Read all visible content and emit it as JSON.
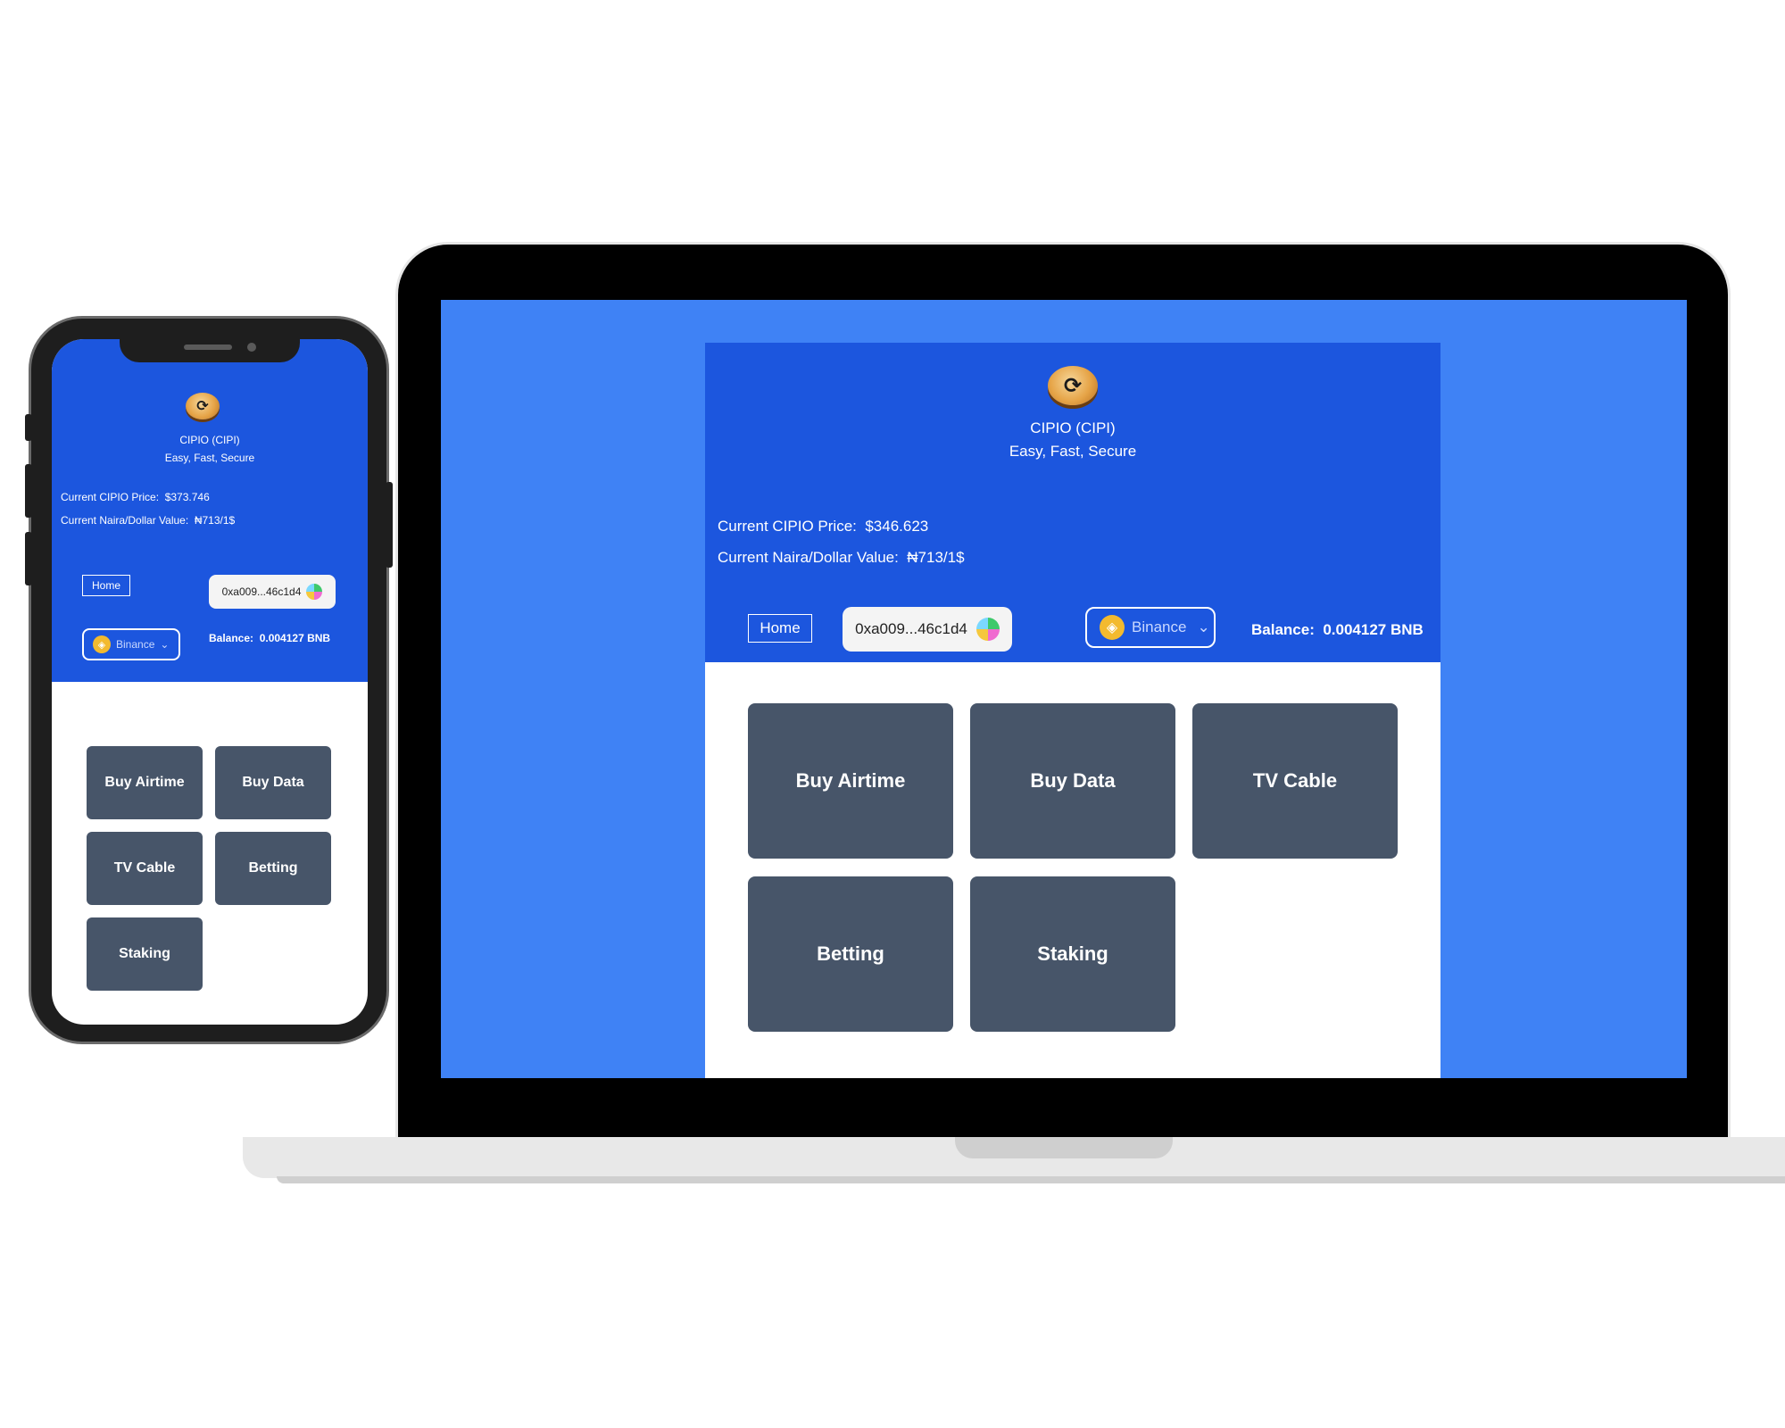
{
  "brand": {
    "logo_glyph": "⟳",
    "title": "CIPIO (CIPI)",
    "tagline": "Easy, Fast, Secure"
  },
  "laptop": {
    "price_label": "Current CIPIO Price:",
    "price_value": "$346.623",
    "naira_label": "Current Naira/Dollar Value:",
    "naira_value": "₦713/1$",
    "home_label": "Home",
    "wallet_address": "0xa009...46c1d4",
    "chain_label": "Binance",
    "balance_label": "Balance:",
    "balance_value": "0.004127 BNB",
    "tiles": [
      "Buy Airtime",
      "Buy Data",
      "TV Cable",
      "Betting",
      "Staking"
    ]
  },
  "phone": {
    "price_label": "Current CIPIO Price:",
    "price_value": "$373.746",
    "naira_label": "Current Naira/Dollar Value:",
    "naira_value": "₦713/1$",
    "home_label": "Home",
    "wallet_address": "0xa009...46c1d4",
    "chain_label": "Binance",
    "balance_label": "Balance:",
    "balance_value": "0.004127 BNB",
    "tiles": [
      "Buy Airtime",
      "Buy Data",
      "TV Cable",
      "Betting",
      "Staking"
    ]
  },
  "icons": {
    "bnb_glyph": "◈",
    "chevron_glyph": "⌄"
  },
  "colors": {
    "page_background": "#3f82f5",
    "header_blue": "#1c56de",
    "tile_slate": "#475569",
    "bnb_yellow": "#f3ba2f"
  }
}
